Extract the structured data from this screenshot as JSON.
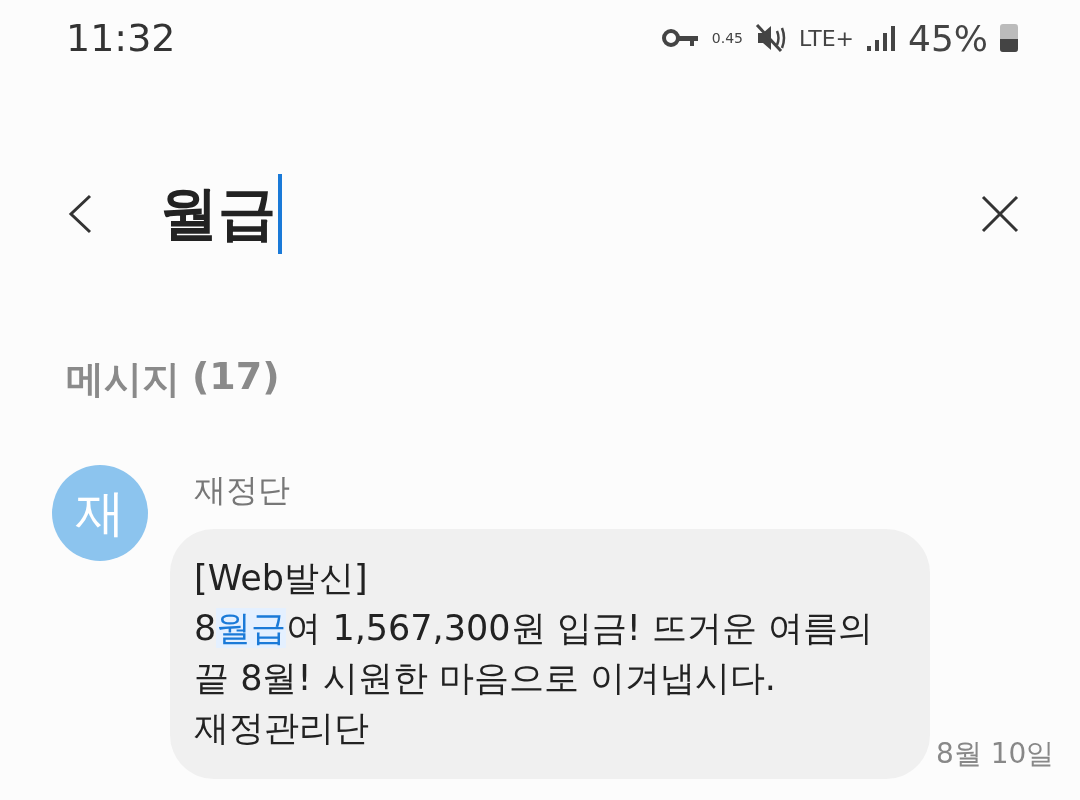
{
  "status_bar": {
    "time": "11:32",
    "speed": "0.45",
    "network": "LTE+",
    "battery_text": "45%"
  },
  "search": {
    "value": "월급"
  },
  "section": {
    "title": "메시지",
    "count": "(17)"
  },
  "messages": [
    {
      "avatar": "재",
      "sender": "재정단",
      "date": "8월 10일",
      "lines": [
        [
          {
            "text": "[Web발신]",
            "highlighted": false
          }
        ],
        [
          {
            "text": "8",
            "highlighted": false
          },
          {
            "text": "월급",
            "highlighted": true
          },
          {
            "text": "여 1,567,300원 입금! 뜨거운 여름의",
            "highlighted": false
          }
        ],
        [
          {
            "text": "끝 8월! 시원한 마음으로 이겨냅시다.",
            "highlighted": false
          }
        ],
        [
          {
            "text": "재정관리단",
            "highlighted": false
          }
        ]
      ]
    }
  ]
}
